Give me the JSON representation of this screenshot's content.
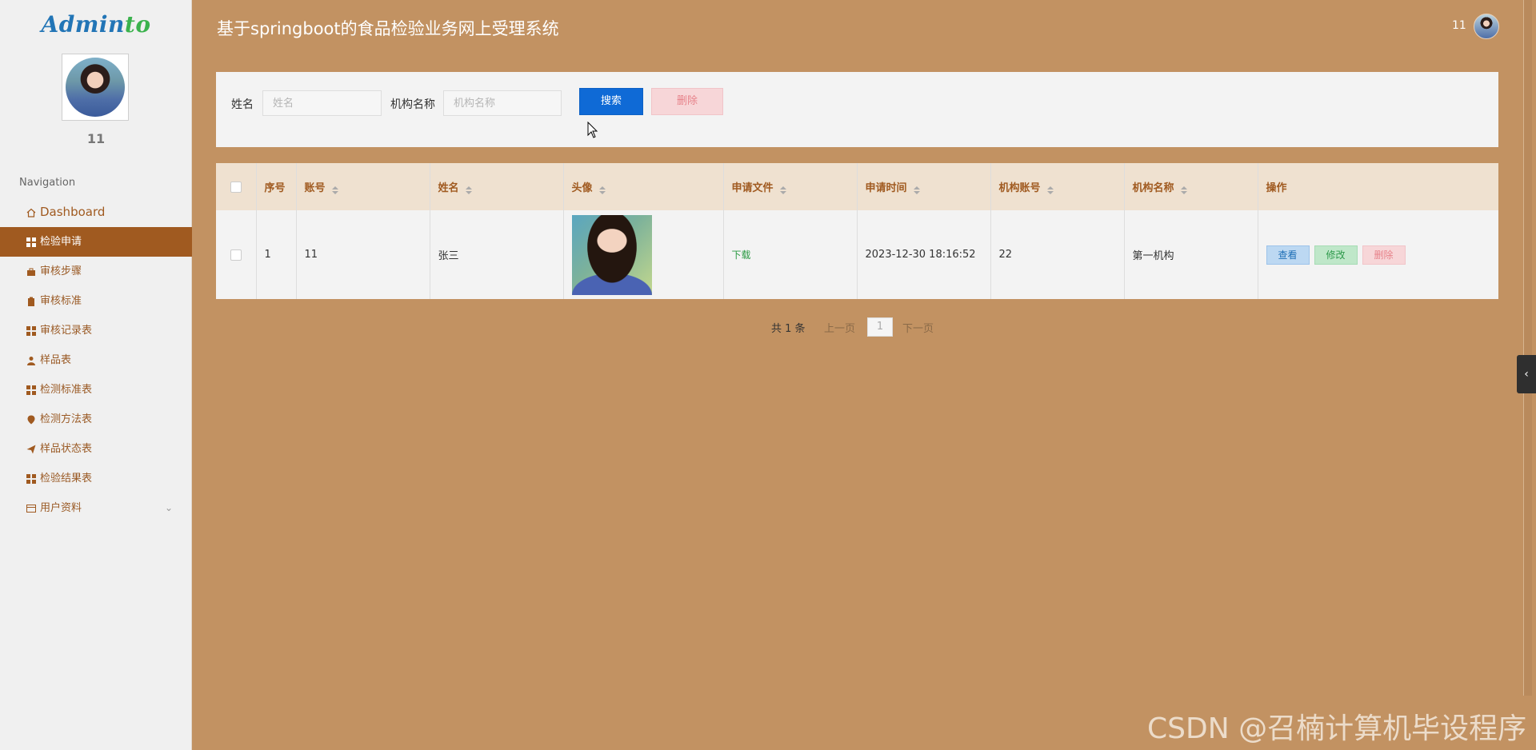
{
  "app": {
    "brand_main": "Admin",
    "brand_tail": "to",
    "page_title": "基于springboot的食品检验业务网上受理系统",
    "top_username": "11"
  },
  "sidebar": {
    "username": "11",
    "nav_title": "Navigation",
    "items": [
      {
        "label": "Dashboard",
        "icon": "home-icon"
      },
      {
        "label": "检验申请",
        "icon": "grid-icon"
      },
      {
        "label": "审核步骤",
        "icon": "briefcase-icon"
      },
      {
        "label": "审核标准",
        "icon": "clipboard-icon"
      },
      {
        "label": "审核记录表",
        "icon": "grid-icon"
      },
      {
        "label": "样品表",
        "icon": "user-icon"
      },
      {
        "label": "检测标准表",
        "icon": "grid-icon"
      },
      {
        "label": "检测方法表",
        "icon": "pin-icon"
      },
      {
        "label": "样品状态表",
        "icon": "send-icon"
      },
      {
        "label": "检验结果表",
        "icon": "grid-icon"
      },
      {
        "label": "用户资料",
        "icon": "card-icon"
      }
    ]
  },
  "search": {
    "name_label": "姓名",
    "name_placeholder": "姓名",
    "org_label": "机构名称",
    "org_placeholder": "机构名称",
    "search_button": "搜索",
    "delete_button": "删除"
  },
  "table": {
    "columns": [
      "序号",
      "账号",
      "姓名",
      "头像",
      "申请文件",
      "申请时间",
      "机构账号",
      "机构名称",
      "操作"
    ],
    "rows": [
      {
        "index": "1",
        "account": "11",
        "name": "张三",
        "file_link": "下载",
        "apply_time": "2023-12-30 18:16:52",
        "org_account": "22",
        "org_name": "第一机构",
        "view_label": "查看",
        "edit_label": "修改",
        "delete_label": "删除"
      }
    ]
  },
  "pagination": {
    "total": "共 1 条",
    "prev": "上一页",
    "current": "1",
    "next": "下一页"
  },
  "watermark": "CSDN @召楠计算机毕设程序",
  "colors": {
    "background": "#c29262",
    "active_nav": "#a05a20",
    "primary": "#0f6ad6",
    "danger_light": "#f7d6d8"
  }
}
